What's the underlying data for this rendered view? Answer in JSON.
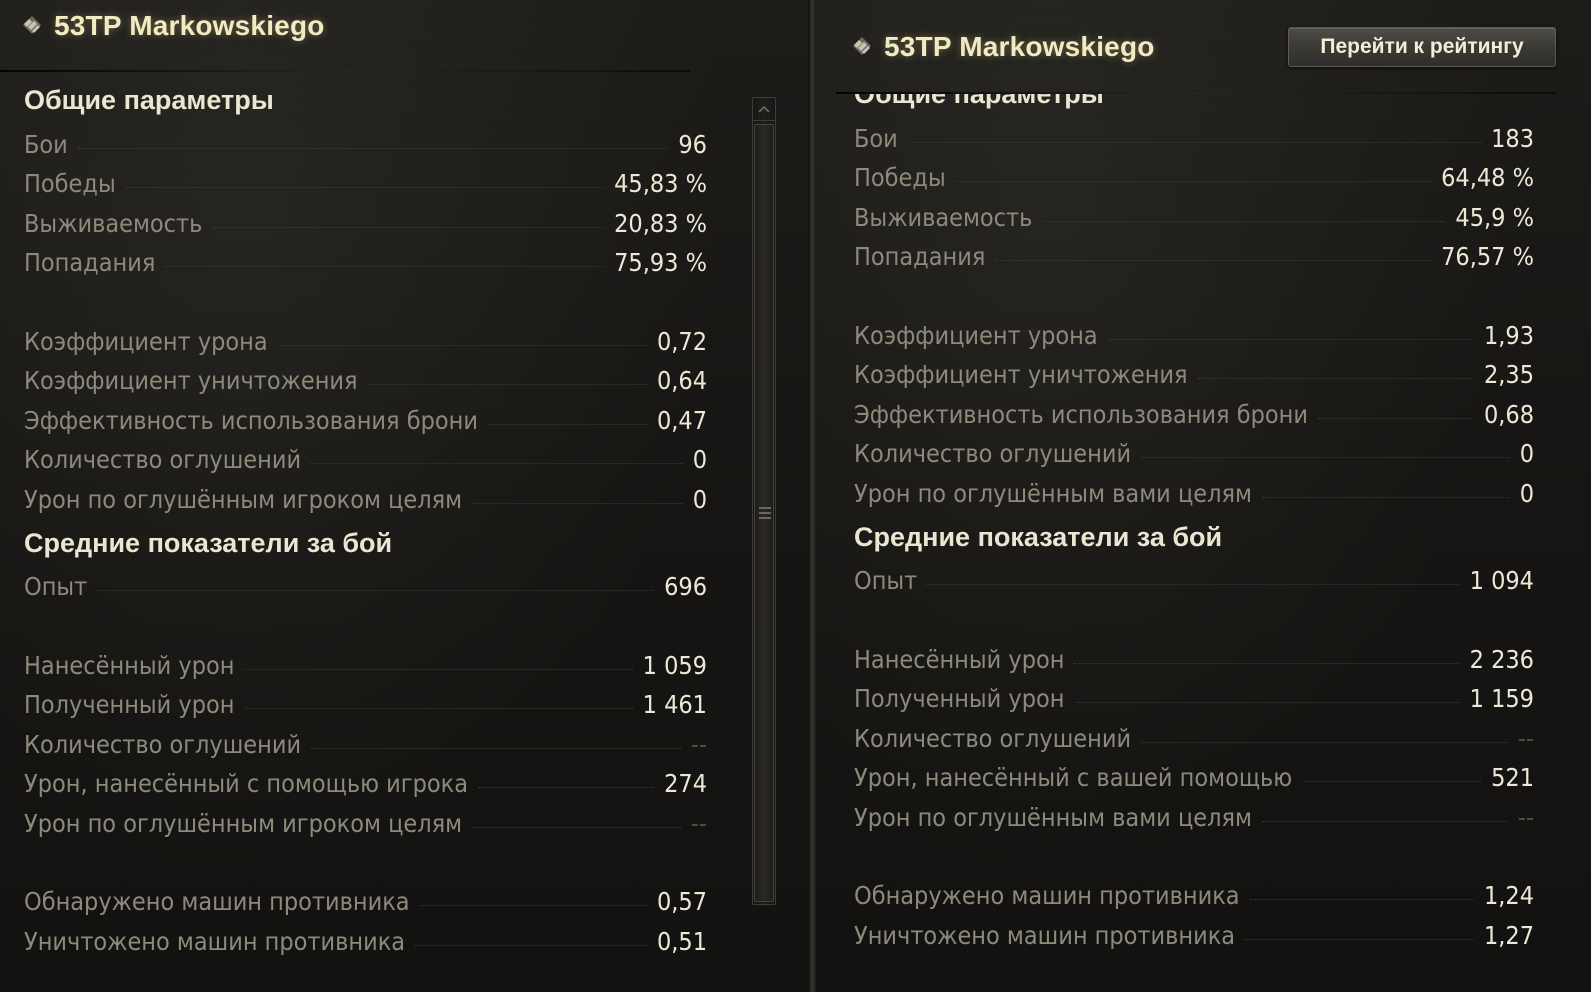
{
  "left": {
    "title": "53TP Markowskiego",
    "sections": [
      {
        "heading": "Общие параметры",
        "rows": [
          {
            "label": "Бои",
            "value": "96"
          },
          {
            "label": "Победы",
            "value": "45,83 %"
          },
          {
            "label": "Выживаемость",
            "value": "20,83 %"
          },
          {
            "label": "Попадания",
            "value": "75,93 %"
          },
          {
            "label": "Коэффициент урона",
            "value": "0,72"
          },
          {
            "label": "Коэффициент уничтожения",
            "value": "0,64"
          },
          {
            "label": "Эффективность использования брони",
            "value": "0,47"
          },
          {
            "label": "Количество оглушений",
            "value": "0"
          },
          {
            "label": "Урон по оглушённым игроком целям",
            "value": "0"
          }
        ]
      },
      {
        "heading": "Средние показатели за бой",
        "rows": [
          {
            "label": "Опыт",
            "value": "696"
          },
          {
            "label": "Нанесённый урон",
            "value": "1 059"
          },
          {
            "label": "Полученный урон",
            "value": "1 461"
          },
          {
            "label": "Количество оглушений",
            "value": "--"
          },
          {
            "label": "Урон, нанесённый с помощью игрока",
            "value": "274"
          },
          {
            "label": "Урон по оглушённым игроком целям",
            "value": "--"
          },
          {
            "label": "Обнаружено машин противника",
            "value": "0,57"
          },
          {
            "label": "Уничтожено машин противника",
            "value": "0,51"
          }
        ]
      }
    ]
  },
  "right": {
    "title": "53TP Markowskiego",
    "rating_button": "Перейти к рейтингу",
    "sections": [
      {
        "heading": "Общие параметры",
        "rows": [
          {
            "label": "Бои",
            "value": "183"
          },
          {
            "label": "Победы",
            "value": "64,48 %"
          },
          {
            "label": "Выживаемость",
            "value": "45,9 %"
          },
          {
            "label": "Попадания",
            "value": "76,57 %"
          },
          {
            "label": "Коэффициент урона",
            "value": "1,93"
          },
          {
            "label": "Коэффициент уничтожения",
            "value": "2,35"
          },
          {
            "label": "Эффективность использования брони",
            "value": "0,68"
          },
          {
            "label": "Количество оглушений",
            "value": "0"
          },
          {
            "label": "Урон по оглушённым вами целям",
            "value": "0"
          }
        ]
      },
      {
        "heading": "Средние показатели за бой",
        "rows": [
          {
            "label": "Опыт",
            "value": "1 094"
          },
          {
            "label": "Нанесённый урон",
            "value": "2 236"
          },
          {
            "label": "Полученный урон",
            "value": "1 159"
          },
          {
            "label": "Количество оглушений",
            "value": "--"
          },
          {
            "label": "Урон, нанесённый с вашей помощью",
            "value": "521"
          },
          {
            "label": "Урон по оглушённым вами целям",
            "value": "--"
          },
          {
            "label": "Обнаружено машин противника",
            "value": "1,24"
          },
          {
            "label": "Уничтожено машин противника",
            "value": "1,27"
          }
        ]
      }
    ]
  },
  "icons": {
    "tier": "tank-class-icon",
    "scroll_up": "scroll-up-arrow-icon",
    "grip": "scroll-grip-icon"
  }
}
